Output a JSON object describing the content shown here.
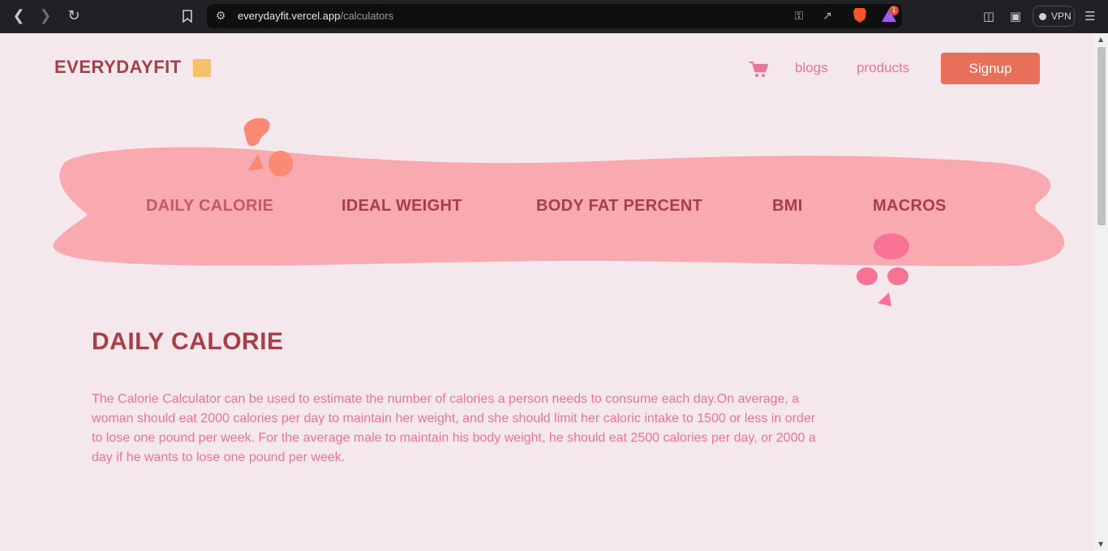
{
  "browser": {
    "url_host": "everydayfit.vercel.app",
    "url_path": "/calculators",
    "vpn_label": "VPN",
    "rewards_badge": "1"
  },
  "header": {
    "logo_text": "EVERYDAYFIT",
    "nav": [
      {
        "label": "blogs"
      },
      {
        "label": "products"
      }
    ],
    "signup_label": "Signup"
  },
  "calculator_tabs": [
    {
      "label": "DAILY CALORIE",
      "active": true
    },
    {
      "label": "IDEAL WEIGHT",
      "active": false
    },
    {
      "label": "BODY FAT PERCENT",
      "active": false
    },
    {
      "label": "BMI",
      "active": false
    },
    {
      "label": "MACROS",
      "active": false
    }
  ],
  "section": {
    "title": "DAILY CALORIE",
    "description": "The Calorie Calculator can be used to estimate the number of calories a person needs to consume each day.On average, a woman should eat 2000 calories per day to maintain her weight, and she should limit her caloric intake to 1500 or less in order to lose one pound per week. For the average male to maintain his body weight, he should eat 2500 calories per day, or 2000 a day if he wants to lose one pound per week."
  },
  "colors": {
    "background": "#f5e8ec",
    "brand_dark": "#a83e47",
    "accent_pink": "#ea7596",
    "signup_bg": "#e8705a",
    "band": "#f8aab0",
    "logo_square": "#f6c06a"
  },
  "icons": [
    "back-icon",
    "forward-icon",
    "reload-icon",
    "bookmark-icon",
    "site-settings-icon",
    "key-icon",
    "share-icon",
    "brave-shield-icon",
    "brave-rewards-icon",
    "sidebar-icon",
    "wallet-icon",
    "menu-icon",
    "cart-icon"
  ]
}
